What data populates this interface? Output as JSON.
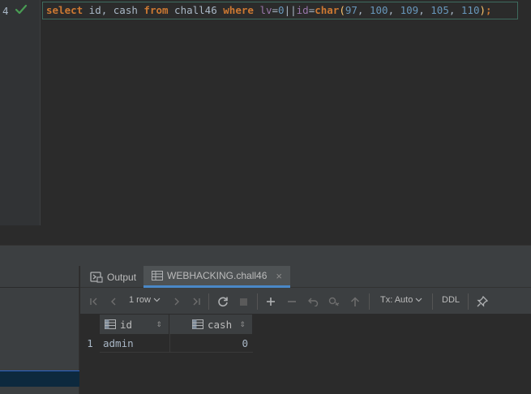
{
  "editor": {
    "line_number": "4",
    "code": {
      "t1": "select",
      "t2": " id, cash ",
      "t3": "from",
      "t4": " chall46 ",
      "t5": "where",
      "t6": " ",
      "t7": "lv",
      "t8": "=",
      "t9": "0",
      "t10": "||",
      "t11": "id",
      "t12": "=",
      "t13": "char",
      "t14": "(",
      "t15": "97",
      "t16": ", ",
      "t17": "100",
      "t18": ", ",
      "t19": "109",
      "t20": ", ",
      "t21": "105",
      "t22": ", ",
      "t23": "110",
      "t24": ")",
      "t25": ";"
    }
  },
  "tabs": {
    "output_label": "Output",
    "table_tab_label": "WEBHACKING.chall46"
  },
  "toolbar": {
    "rows_label": "1 row",
    "tx_label": "Tx: Auto",
    "ddl_label": "DDL"
  },
  "grid": {
    "columns": [
      "id",
      "cash"
    ],
    "rows": [
      {
        "num": "1",
        "id": "admin",
        "cash": "0"
      }
    ]
  },
  "colors": {
    "keyword": "#cc7832",
    "identifier": "#9876aa",
    "number": "#6897bb",
    "function": "#ffc66d",
    "accent": "#4a88c7"
  }
}
